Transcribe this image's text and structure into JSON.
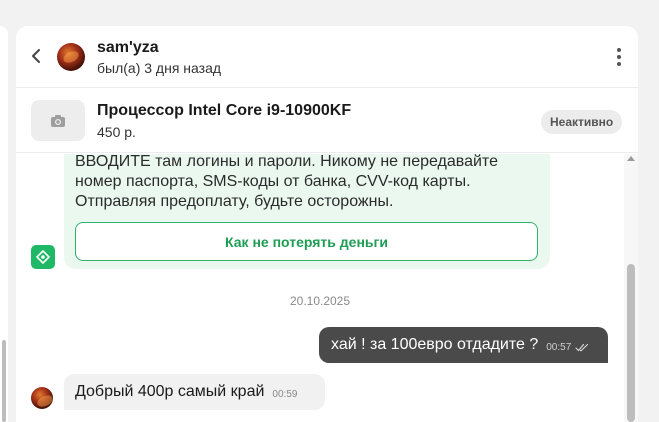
{
  "header": {
    "user_name": "sam'yza",
    "user_status": "был(а) 3 дня назад"
  },
  "product": {
    "title": "Процессор Intel Core i9-10900KF",
    "price": "450 р.",
    "status": "Неактивно"
  },
  "warning": {
    "text": "ВВОДИТЕ там логины и пароли. Никому не передавайте номер паспорта, SMS-коды от банка, CVV-код карты. Отправляя предоплату, будьте осторожны.",
    "button_label": "Как не потерять деньги"
  },
  "messages": {
    "date_separator": "20.10.2025",
    "outgoing": {
      "text": "хай ! за 100евро отдадите ?",
      "time": "00:57"
    },
    "incoming": {
      "text": "Добрый 400р самый край",
      "time": "00:59"
    }
  },
  "icons": {
    "back": "chevron-left-icon",
    "menu": "more-vertical-icon",
    "camera": "camera-icon",
    "bot": "shield-bot-icon",
    "read": "double-check-icon"
  },
  "colors": {
    "accent_green": "#1fb866",
    "warning_bg": "#eaf8ef",
    "outgoing_bubble": "#4a4a4a",
    "incoming_bubble": "#f1f1f1"
  }
}
